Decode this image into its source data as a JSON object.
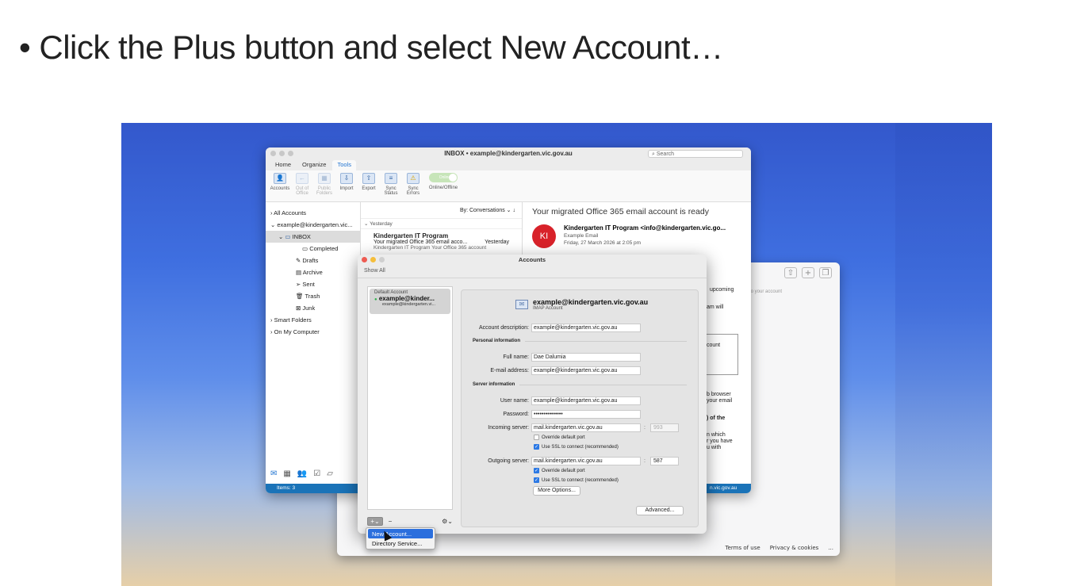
{
  "instruction": {
    "bullet": "•",
    "part1": "Click the ",
    "bold1": "Plus",
    "part2": " button and select ",
    "bold2": "New Account…"
  },
  "outlook": {
    "window_title": "INBOX • example@kindergarten.vic.gov.au",
    "search_placeholder": "Search",
    "tabs": [
      "Home",
      "Organize",
      "Tools"
    ],
    "ribbon": {
      "accounts": "Accounts",
      "out_of_office": "Out of Office",
      "public_folders": "Public Folders",
      "import": "Import",
      "export": "Export",
      "sync_status": "Sync Status",
      "sync_errors": "Sync Errors",
      "online_toggle": "Online",
      "online_offline": "Online/Offline"
    },
    "sidebar": {
      "all_accounts": "All Accounts",
      "account": "example@kindergarten.vic...",
      "inbox": "INBOX",
      "completed": "Completed",
      "drafts": "Drafts",
      "archive": "Archive",
      "sent": "Sent",
      "trash": "Trash",
      "junk": "Junk",
      "smart_folders": "Smart Folders",
      "on_my_computer": "On My Computer"
    },
    "list": {
      "sort": "By: Conversations ⌄  ↓",
      "group": "Yesterday",
      "from": "Kindergarten IT Program",
      "subject": "Your migrated Office 365 email acco...",
      "date": "Yesterday",
      "preview": "Kindergarten IT Program Your Office 365 account"
    },
    "reading": {
      "title": "Your migrated Office 365 email account is ready",
      "avatar": "KI",
      "from": "Kindergarten IT Program <info@kindergarten.vic.go...",
      "to": "Example Email",
      "date": "Friday, 27 March 2026 at 2:05 pm",
      "behind1": "upcoming",
      "behind2": "am will",
      "behind3": "count",
      "behind4": "b browser\nyour email",
      "behind5": ") of the",
      "behind6": "n which\nr you have\nu with",
      "behind7": "n.vic.gov.au"
    },
    "status": "Items: 3"
  },
  "browser": {
    "hint": "to your account",
    "terms": "Terms of use",
    "privacy": "Privacy & cookies",
    "more": "..."
  },
  "accounts_dialog": {
    "title": "Accounts",
    "show_all": "Show All",
    "default_label": "Default Account",
    "account_name": "example@kinder...",
    "account_email": "example@kindergarten.vi...",
    "header_email": "example@kindergarten.vic.gov.au",
    "header_type": "IMAP Account",
    "fields": {
      "description_label": "Account description:",
      "description": "example@kindergarten.vic.gov.au",
      "personal_info": "Personal information",
      "full_name_label": "Full name:",
      "full_name": "Dae Dalumia",
      "email_label": "E-mail address:",
      "email": "example@kindergarten.vic.gov.au",
      "server_info": "Server information",
      "user_label": "User name:",
      "user": "example@kindergarten.vic.gov.au",
      "password_label": "Password:",
      "password": "•••••••••••••••",
      "incoming_label": "Incoming server:",
      "incoming": "mail.kindergarten.vic.gov.au",
      "incoming_port": "993",
      "override_in": "Override default port",
      "ssl_in": "Use SSL to connect (recommended)",
      "outgoing_label": "Outgoing server:",
      "outgoing": "mail.kindergarten.vic.gov.au",
      "outgoing_port": "587",
      "override_out": "Override default port",
      "ssl_out": "Use SSL to connect (recommended)",
      "more_options": "More Options...",
      "advanced": "Advanced..."
    },
    "plus": "+⌄",
    "minus": "−",
    "gear": "⚙⌄"
  },
  "menu": {
    "new_account": "New Account...",
    "directory_service": "Directory Service..."
  }
}
